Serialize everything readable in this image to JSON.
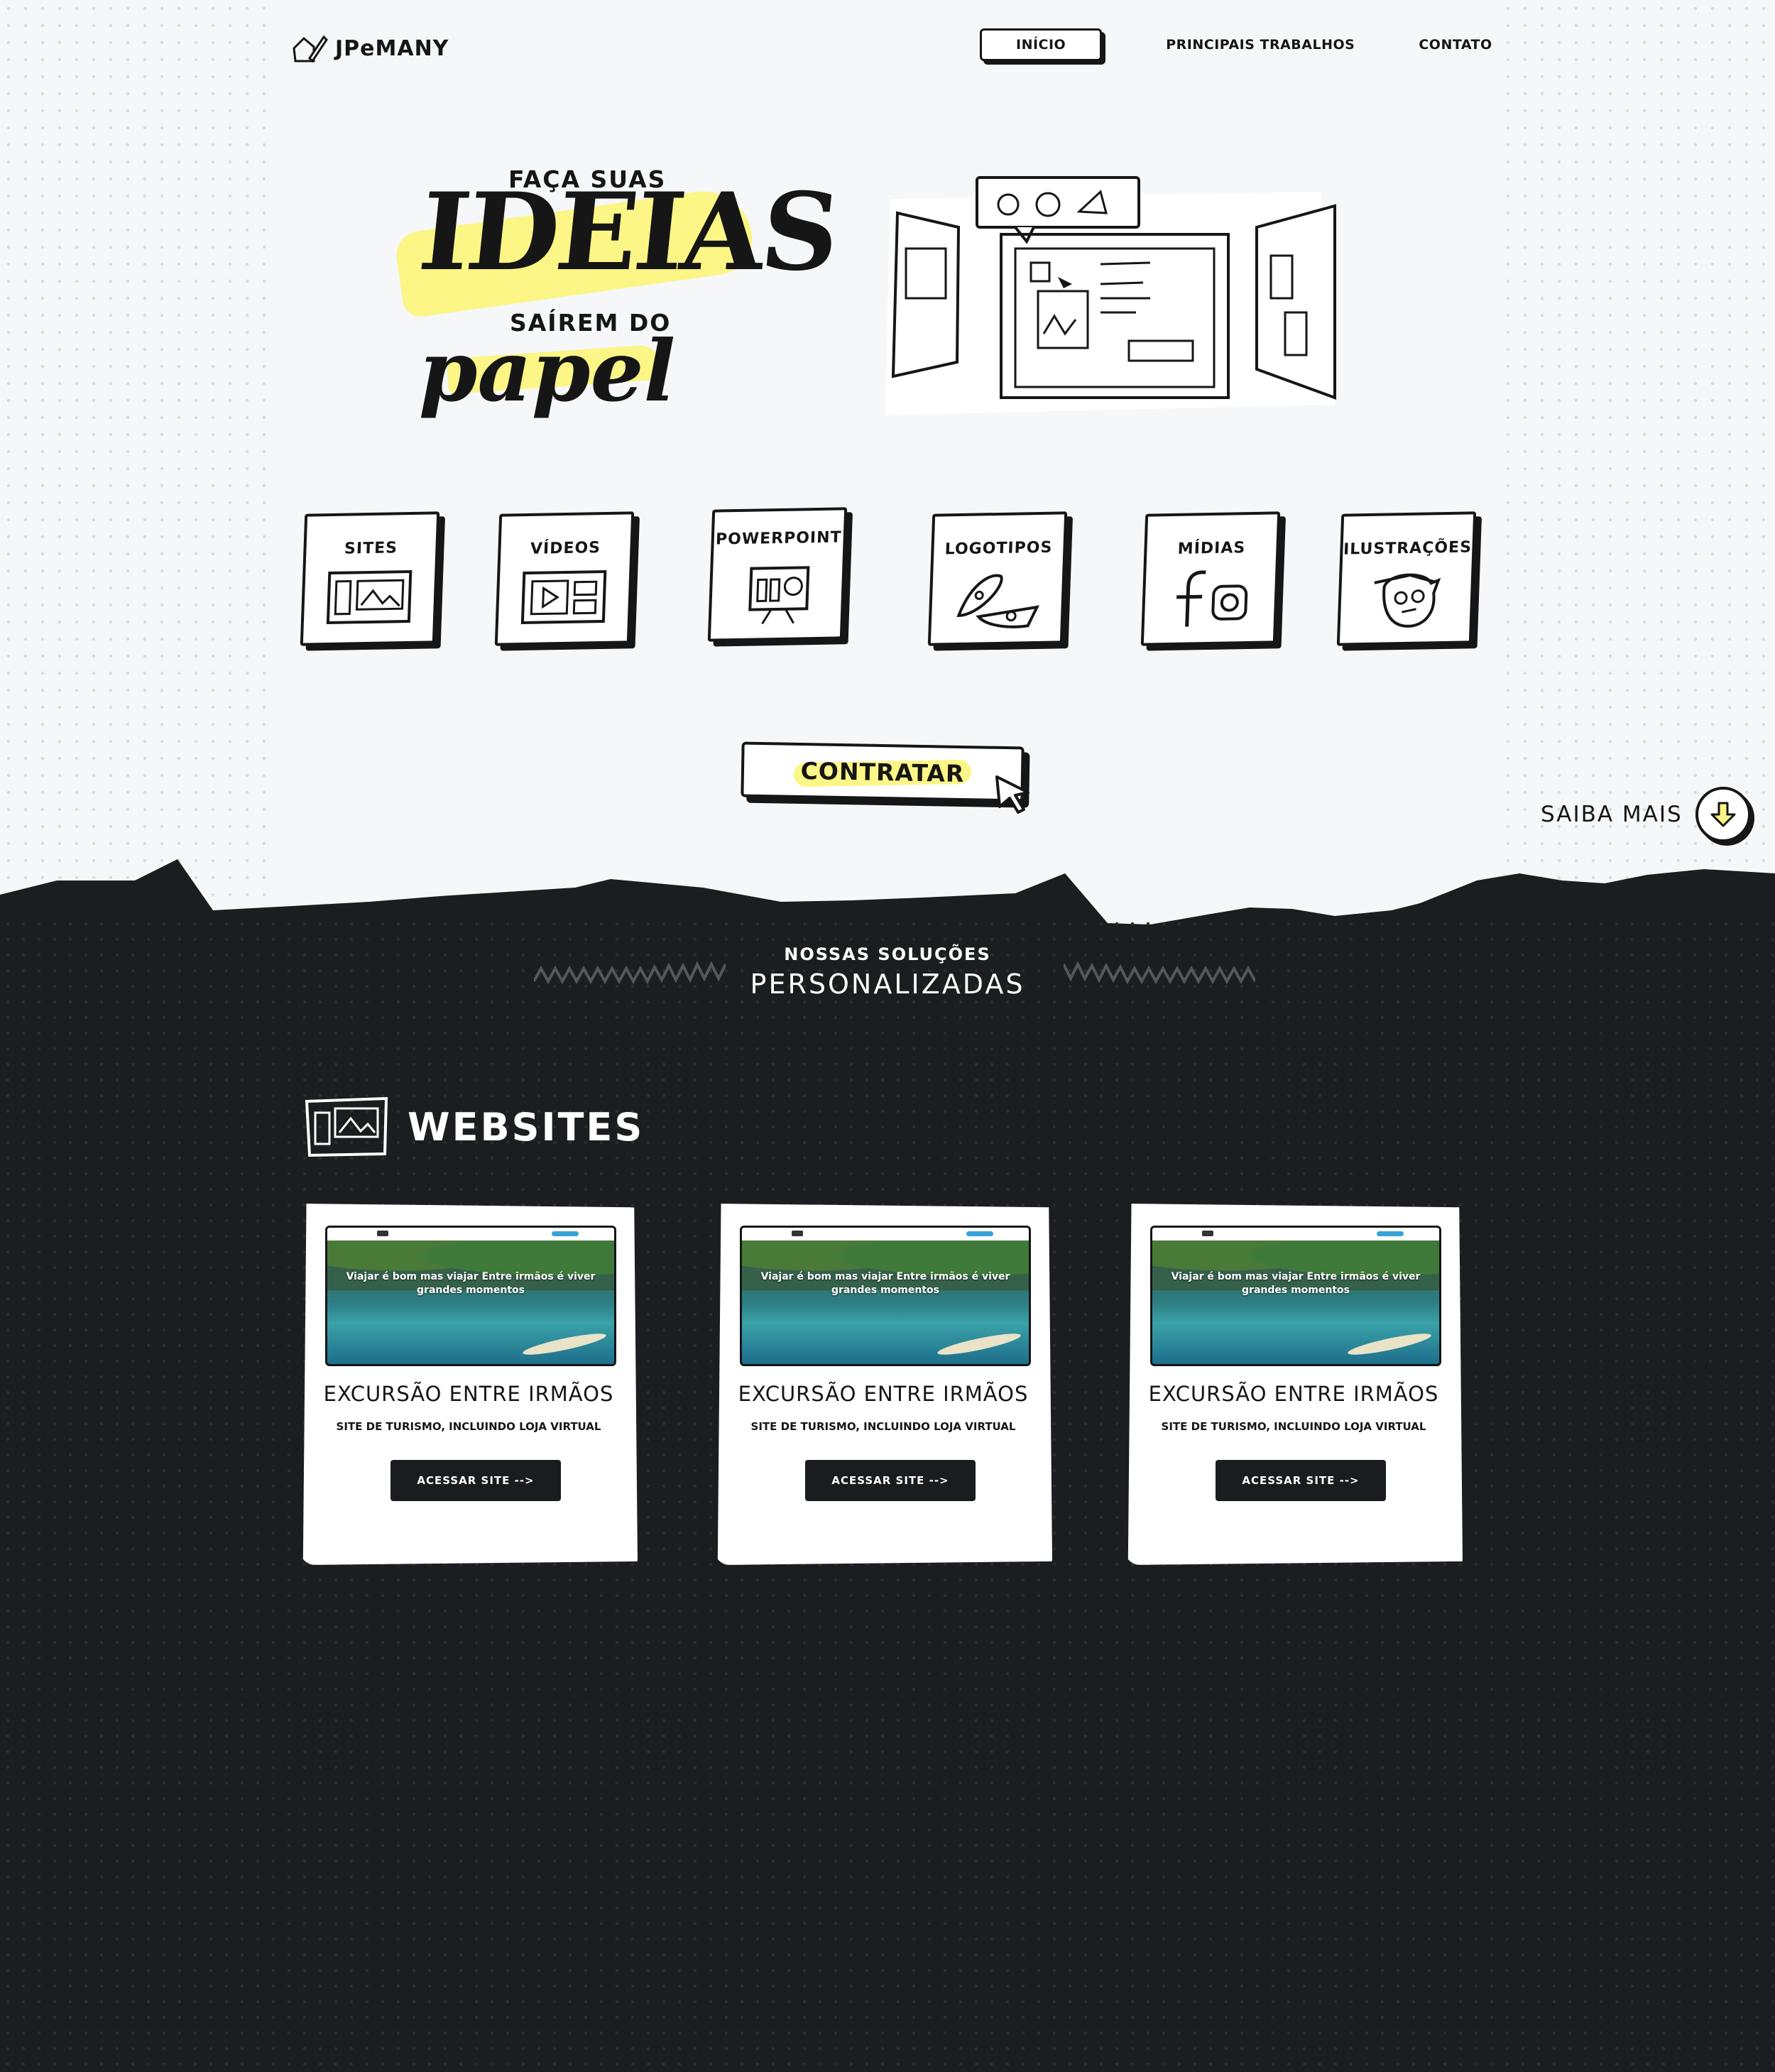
{
  "brand": {
    "logo_text": "JPeMANY"
  },
  "nav": {
    "items": [
      "INÍCIO",
      "PRINCIPAIS TRABALHOS",
      "CONTATO"
    ]
  },
  "hero": {
    "line1": "FAÇA SUAS",
    "line2": "IDEIAS",
    "line3": "SAÍREM DO",
    "line4": "papel"
  },
  "services": [
    {
      "label": "SITES",
      "icon": "website-icon"
    },
    {
      "label": "VÍDEOS",
      "icon": "video-icon"
    },
    {
      "label": "POWERPOINT",
      "icon": "presentation-icon"
    },
    {
      "label": "LOGOTIPOS",
      "icon": "pizza-logo-icon"
    },
    {
      "label": "MÍDIAS",
      "icon": "social-media-icon"
    },
    {
      "label": "ILUSTRAÇÕES",
      "icon": "character-icon"
    }
  ],
  "cta": {
    "label": "CONTRATAR"
  },
  "saiba": {
    "label": "SAIBA MAIS"
  },
  "solutions": {
    "kicker": "NOSSAS SOLUÇÕES",
    "title": "PERSONALIZADAS"
  },
  "websites": {
    "heading": "WEBSITES",
    "projects": [
      {
        "preview_text": "Viajar é bom mas viajar Entre irmãos é viver grandes momentos",
        "title": "EXCURSÃO ENTRE IRMÃOS",
        "subtitle": "SITE DE TURISMO, INCLUINDO LOJA VIRTUAL",
        "button": "ACESSAR SITE -->"
      },
      {
        "preview_text": "Viajar é bom mas viajar Entre irmãos é viver grandes momentos",
        "title": "EXCURSÃO ENTRE IRMÃOS",
        "subtitle": "SITE DE TURISMO, INCLUINDO LOJA VIRTUAL",
        "button": "ACESSAR SITE -->"
      },
      {
        "preview_text": "Viajar é bom mas viajar Entre irmãos é viver grandes momentos",
        "title": "EXCURSÃO ENTRE IRMÃOS",
        "subtitle": "SITE DE TURISMO, INCLUINDO LOJA VIRTUAL",
        "button": "ACESSAR SITE -->"
      }
    ]
  },
  "colors": {
    "ink": "#161616",
    "paper": "#f6f7f9",
    "highlight": "#fbf686",
    "dark": "#1c1d20",
    "accent_blue": "#36a2d8"
  }
}
